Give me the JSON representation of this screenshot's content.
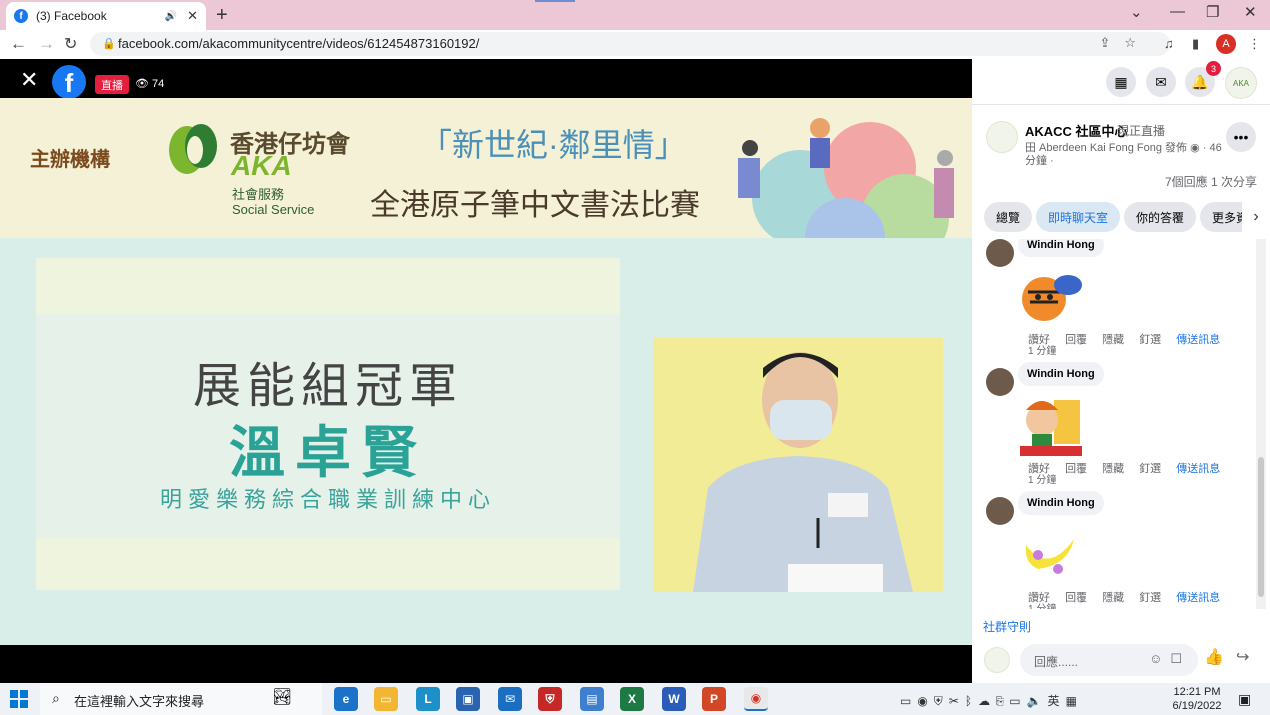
{
  "browser": {
    "tab_title": "(3) Facebook",
    "url": "facebook.com/akacommunitycentre/videos/612454873160192/",
    "profile_initial": "A"
  },
  "video": {
    "live_label": "直播",
    "viewers": "74",
    "organizer_label": "主辦機構",
    "org_name_cn": "香港仔坊會",
    "org_name_en": "AKA",
    "org_sub_cn": "社會服務",
    "org_sub_en": "Social Service",
    "event_title": "「新世紀·鄰里情」",
    "event_subtitle": "全港原子筆中文書法比賽",
    "award": "展能組冠軍",
    "winner": "溫卓賢",
    "school": "明愛樂務綜合職業訓練中心"
  },
  "sidebar": {
    "notification_count": "3",
    "page_name": "AKACC 社區中心",
    "live_status": "現正直播",
    "meta_line1": "田 Aberdeen Kai Fong Fong 發佈 ◉ · 46",
    "meta_line2": "分鐘 ·",
    "stats": "7個回應  1 次分享",
    "tabs": [
      "總覽",
      "即時聊天室",
      "你的答覆",
      "更多資"
    ],
    "comments": [
      {
        "name": "Windin Hong",
        "actions": [
          "讚好",
          "回覆",
          "隱藏",
          "釘選"
        ],
        "send": "傳送訊息",
        "time": "1 分鐘"
      },
      {
        "name": "Windin Hong",
        "actions": [
          "讚好",
          "回覆",
          "隱藏",
          "釘選"
        ],
        "send": "傳送訊息",
        "time": "1 分鐘"
      },
      {
        "name": "Windin Hong",
        "actions": [
          "讚好",
          "回覆",
          "隱藏",
          "釘選"
        ],
        "send": "傳送訊息",
        "time": "1 分鐘"
      }
    ],
    "community_rules": "社群守則",
    "reply_placeholder": "回應......"
  },
  "taskbar": {
    "search_placeholder": "在這裡輸入文字來搜尋",
    "time": "12:21 PM",
    "date": "6/19/2022",
    "ime": "英"
  },
  "colors": {
    "facebook_blue": "#1877f2",
    "live_red": "#e41e3f",
    "winner_teal": "#2aa296"
  }
}
